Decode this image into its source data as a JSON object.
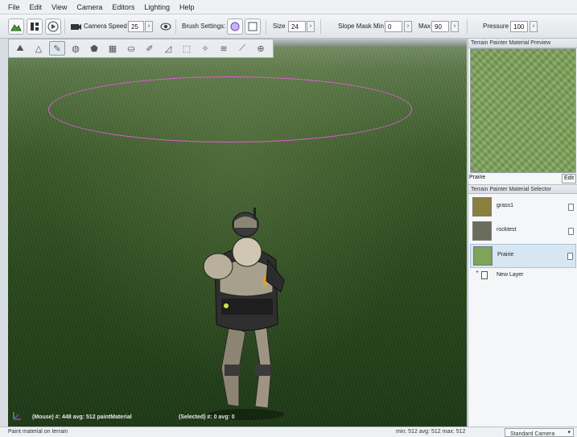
{
  "menu": [
    "File",
    "Edit",
    "View",
    "Camera",
    "Editors",
    "Lighting",
    "Help"
  ],
  "toolbar": {
    "camera_speed_label": "Camera Speed",
    "camera_speed_value": "25",
    "brush_settings_label": "Brush Settings:",
    "size_label": "Size",
    "size_value": "24",
    "slope_mask_label": "Slope Mask",
    "min_label": "Min",
    "min_value": "0",
    "max_label": "Max",
    "max_value": "90",
    "pressure_label": "Pressure",
    "pressure_value": "100"
  },
  "viewport": {
    "mouse_readout": "(Mouse) #: 448  avg: 512 paintMaterial",
    "selected_readout": "(Selected) #: 0  avg: 0"
  },
  "preview_panel": {
    "title": "Terrain Painter Material Preview",
    "material_name": "Prairie",
    "edit_label": "Edit"
  },
  "selector_panel": {
    "title": "Terrain Painter Material Selector",
    "materials": [
      {
        "name": "grass1",
        "color": "#8a7f3c"
      },
      {
        "name": "rocktest",
        "color": "#6c6c5e"
      },
      {
        "name": "Prairie",
        "color": "#7ea35a"
      }
    ],
    "selected_index": 2,
    "new_layer_label": "New Layer"
  },
  "status": {
    "hint": "Paint material on terrain",
    "stats": "min: 512  avg: 512  max: 512",
    "camera_mode": "Standard Camera"
  },
  "colors": {
    "brush_ring": "#e35ad6",
    "selection": "#d7e6f3"
  }
}
